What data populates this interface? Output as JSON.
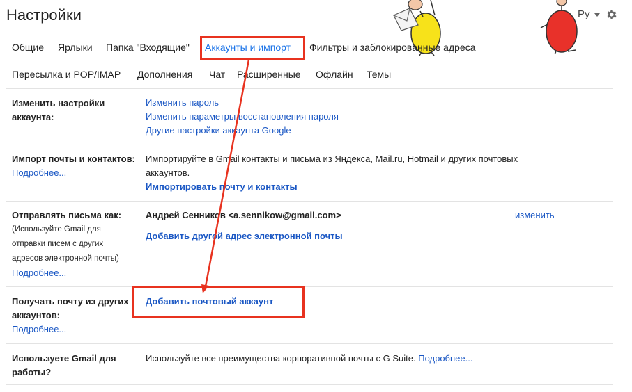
{
  "header": {
    "title": "Настройки",
    "language": "Ру"
  },
  "tabs": [
    {
      "label": "Общие"
    },
    {
      "label": "Ярлыки"
    },
    {
      "label": "Папка \"Входящие\""
    },
    {
      "label": "Аккаунты и импорт",
      "active": true
    },
    {
      "label": "Фильтры и заблокированные адреса"
    },
    {
      "label": "Пересылка и POP/IMAP"
    },
    {
      "label": "Дополнения"
    },
    {
      "label": "Чат"
    },
    {
      "label": "Расширенные"
    },
    {
      "label": "Офлайн"
    },
    {
      "label": "Темы"
    }
  ],
  "sections": {
    "account": {
      "label_line1": "Изменить настройки",
      "label_line2": "аккаунта:",
      "links": [
        "Изменить пароль",
        "Изменить параметры восстановления пароля",
        "Другие настройки аккаунта Google"
      ]
    },
    "import": {
      "label": "Импорт почты и контактов:",
      "more": "Подробнее...",
      "desc_line1": "Импортируйте в Gmail контакты и письма из Яндекса, Mail.ru, Hotmail и других почтовых",
      "desc_line2": "аккаунтов.",
      "action": "Импортировать почту и контакты"
    },
    "send_as": {
      "label": "Отправлять письма как:",
      "sub_line1": "(Используйте Gmail для",
      "sub_line2": "отправки писем с других",
      "sub_line3": "адресов электронной почты)",
      "more": "Подробнее...",
      "address": "Андрей Сенников <a.sennikow@gmail.com>",
      "edit": "изменить",
      "add": "Добавить другой адрес электронной почты"
    },
    "fetch": {
      "label_line1": "Получать почту из других",
      "label_line2": "аккаунтов:",
      "more": "Подробнее...",
      "add": "Добавить почтовый аккаунт"
    },
    "work": {
      "label_line1": "Используете Gmail для",
      "label_line2": "работы?",
      "desc": "Используйте все преимущества корпоративной почты с G Suite.",
      "more": "Подробнее..."
    }
  },
  "colors": {
    "accent": "#1a73e8",
    "link": "#1a57c4",
    "annotation": "#e8321f"
  },
  "icons": [
    "gear-icon",
    "caret-down-icon",
    "mascot-yellow-icon",
    "mascot-red-icon"
  ]
}
